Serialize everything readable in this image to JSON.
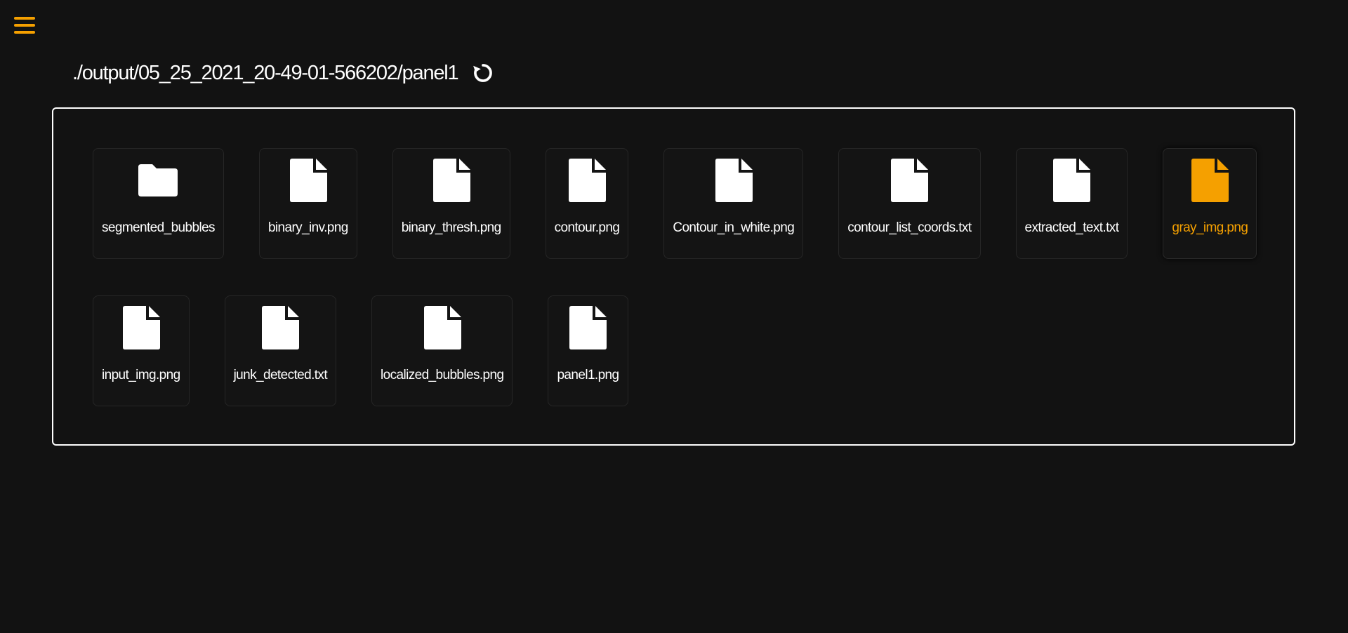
{
  "header": {
    "path": "./output/05_25_2021_20-49-01-566202/panel1"
  },
  "colors": {
    "accent": "#f5a000",
    "background": "#121212",
    "text": "#ffffff"
  },
  "files": [
    {
      "name": "segmented_bubbles",
      "type": "folder",
      "icon": "folder-icon",
      "selected": false
    },
    {
      "name": "binary_inv.png",
      "type": "file",
      "icon": "file-icon",
      "selected": false
    },
    {
      "name": "binary_thresh.png",
      "type": "file",
      "icon": "file-icon",
      "selected": false
    },
    {
      "name": "contour.png",
      "type": "file",
      "icon": "file-icon",
      "selected": false
    },
    {
      "name": "Contour_in_white.png",
      "type": "file",
      "icon": "file-icon",
      "selected": false
    },
    {
      "name": "contour_list_coords.txt",
      "type": "file",
      "icon": "file-icon",
      "selected": false
    },
    {
      "name": "extracted_text.txt",
      "type": "file",
      "icon": "file-icon",
      "selected": false
    },
    {
      "name": "gray_img.png",
      "type": "file",
      "icon": "file-icon",
      "selected": true
    },
    {
      "name": "input_img.png",
      "type": "file",
      "icon": "file-icon",
      "selected": false
    },
    {
      "name": "junk_detected.txt",
      "type": "file",
      "icon": "file-icon",
      "selected": false
    },
    {
      "name": "localized_bubbles.png",
      "type": "file",
      "icon": "file-icon",
      "selected": false
    },
    {
      "name": "panel1.png",
      "type": "file",
      "icon": "file-icon",
      "selected": false
    }
  ]
}
